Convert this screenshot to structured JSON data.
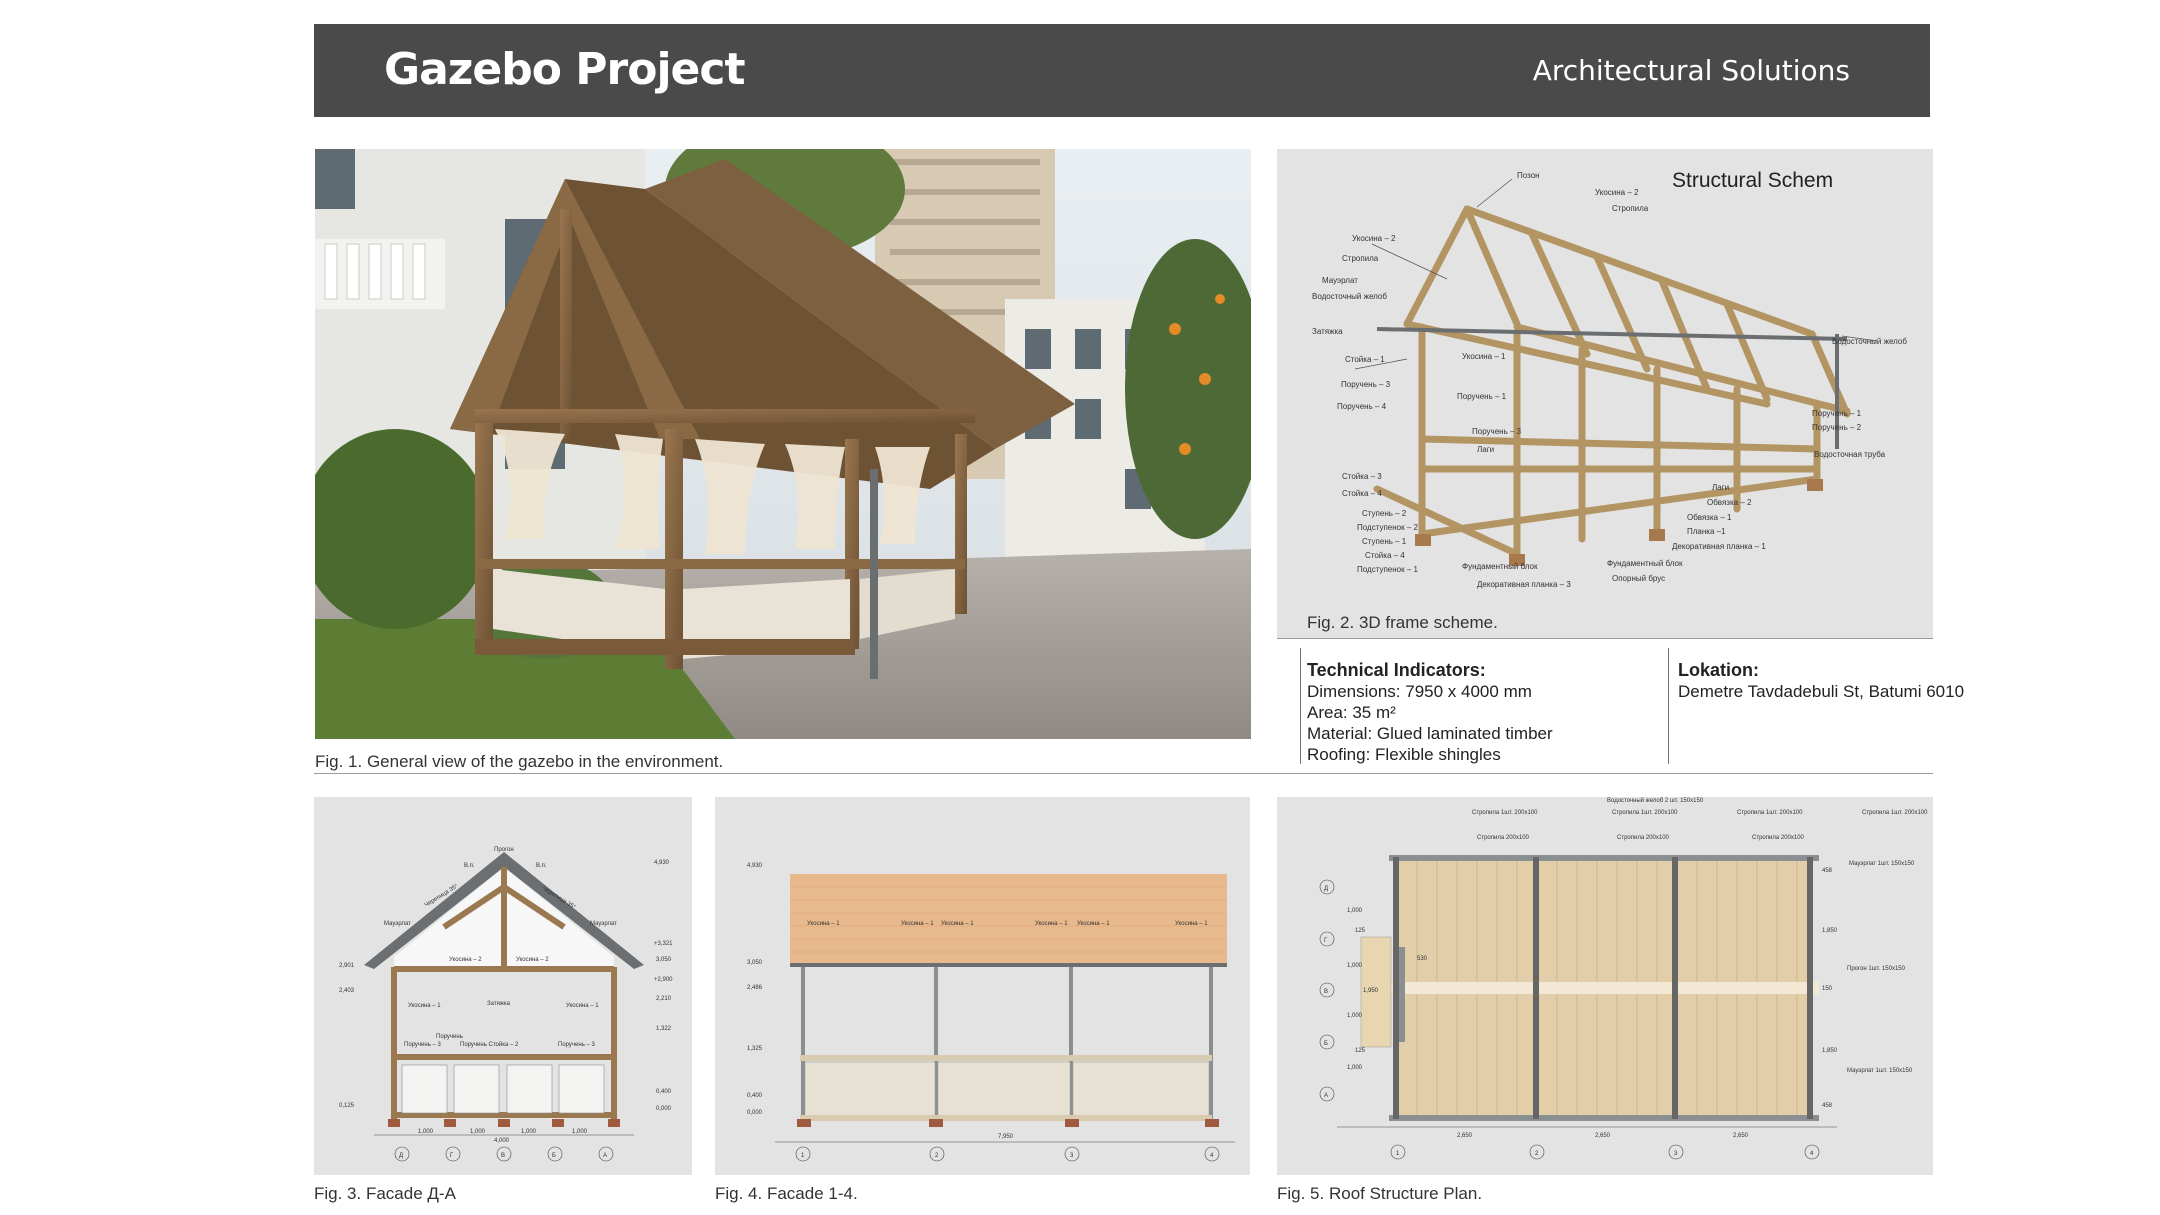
{
  "header": {
    "title": "Gazebo Project",
    "subtitle": "Architectural Solutions"
  },
  "fig1": {
    "caption": "Fig. 1. General view of the gazebo in the environment."
  },
  "fig2": {
    "title": "Structural Schem",
    "caption": "Fig. 2. 3D frame scheme.",
    "labels": {
      "pozon": "Позон",
      "ukosina2_top": "Укосина – 2",
      "stropila_top": "Стропила",
      "ukosina2_left": "Укосина – 2",
      "stropila_left": "Стропила",
      "mauerlat": "Мауэрлат",
      "vodostok_left": "Водосточный желоб",
      "zatyazhka": "Затяжка",
      "stoika1": "Стойка – 1",
      "ukosina1": "Укосина – 1",
      "poruchen3": "Поручень – 3",
      "poruchen4": "Поручень – 4",
      "poruchen1_mid": "Поручень – 1",
      "poruchen3_mid": "Поручень – 3",
      "lagi_mid": "Лаги",
      "stoika3": "Стойка – 3",
      "stoika4": "Стойка – 4",
      "stupen2": "Ступень – 2",
      "podstupenok2": "Подступенок – 2",
      "stupen1": "Ступень – 1",
      "stoika4b": "Стойка – 4",
      "podstupenok1": "Подступенок – 1",
      "fund_block_left": "Фундаментный блок",
      "dekor_planka3": "Декоративная планка – 3",
      "vodostok_right": "Водосточный желоб",
      "poruchen1_right": "Поручень – 1",
      "poruchen2_right": "Поручень – 2",
      "vodostok_truba": "Водосточная труба",
      "lagi_right": "Лаги",
      "obvyazka2": "Обвязка – 2",
      "obvyazka1": "Обвязка – 1",
      "planka1": "Планка –1",
      "dekor_planka1": "Декоративная планка – 1",
      "fund_block_right": "Фундаментный блок",
      "opornyi_brus": "Опорный брус"
    }
  },
  "tech": {
    "heading": "Technical Indicators:",
    "dimensions": "Dimensions: 7950 x 4000 mm",
    "area": "Area: 35 m²",
    "material": "Material: Glued laminated timber",
    "roofing": "Roofing: Flexible shingles"
  },
  "location": {
    "heading": "Lokation:",
    "address": "Demetre Tavdadebuli St, Batumi 6010"
  },
  "fig3": {
    "caption": "Fig. 3. Facade Д-А",
    "labels": {
      "pozon": "Прогон",
      "vp_left": "В.п.",
      "vp_right": "В.п.",
      "cherepica_left": "Черепица 35°",
      "cherepica_right": "Черепица 35°",
      "mauerlat_left": "Мауэрлат",
      "mauerlat_right": "Мауэрлат",
      "ukosina2_a": "Укосина – 2",
      "ukosina2_b": "Укосина – 2",
      "zatyazhka": "Затяжка",
      "ukosina1_a": "Укосина – 1",
      "ukosina1_b": "Укосина – 1",
      "poruchen1": "Поручень",
      "poruchen3_a": "Поручень – 3",
      "poruchen_stoika": "Поручень Стойка – 2",
      "poruchen3_b": "Поручень – 3",
      "lvl_4930": "4,930",
      "lvl_3321": "+3,321",
      "lvl_3050": "3,050",
      "lvl_2900": "+2,900",
      "lvl_2210": "2,210",
      "lvl_1322": "1,322",
      "lvl_0400": "0,400",
      "lvl_0000": "0,000",
      "lvl_2901": "2,901",
      "lvl_2403": "2,403",
      "lvl_0125": "0,125",
      "dim_1000a": "1,000",
      "dim_1000b": "1,000",
      "dim_1000c": "1,000",
      "dim_1000d": "1,000",
      "dim_total": "4,000",
      "axis_d": "Д",
      "axis_g": "Г",
      "axis_v": "В",
      "axis_b": "Б",
      "axis_a": "А"
    }
  },
  "fig4": {
    "caption": "Fig. 4. Facade 1-4.",
    "labels": {
      "lvl_4930": "4,930",
      "lvl_3050": "3,050",
      "lvl_2486": "2,486",
      "lvl_1325": "1,325",
      "lvl_0400": "0,400",
      "lvl_0000": "0,000",
      "ukosina_1a": "Укосина – 1",
      "ukosina_1b": "Укосина – 1",
      "ukosina_1c": "Укосина – 1",
      "ukosina_1d": "Укосина – 1",
      "ukosina_1e": "Укосина – 1",
      "ukosina_1f": "Укосина – 1",
      "dim_total": "7,950",
      "axis_1": "1",
      "axis_2": "2",
      "axis_3": "3",
      "axis_4": "4"
    }
  },
  "fig5": {
    "caption": "Fig. 5. Roof Structure Plan.",
    "labels": {
      "vodostok": "Водосточный желоб 2 шт. 150х150",
      "stropila_a": "Стропила 1шт. 200х100",
      "stropila_b": "Стропила 200х100",
      "stropila_c": "Стропила 1шт. 200х100",
      "stropila_d": "Стропила 200х100",
      "stropila_e": "Стропила 1шт. 200х100",
      "stropila_f": "Стропила 200х100",
      "stropila_g": "Стропила 1шт. 200х100",
      "mauerlat_top": "Мауэрлат 1шт. 150х150",
      "progon": "Прогон 1шт. 150х150",
      "mauerlat_bottom": "Мауэрлат 1шт. 150х150",
      "spacing": "530",
      "dim_2650a": "2,650",
      "dim_2650b": "2,650",
      "dim_2650c": "2,650",
      "dim_1000a": "1,000",
      "dim_1000b": "1,000",
      "dim_1000c": "1,000",
      "dim_1000d": "1,000",
      "dim_125a": "125",
      "dim_125b": "125",
      "dim_1950": "1,950",
      "dim_458a": "458",
      "dim_1850a": "1,850",
      "dim_150": "150",
      "dim_1850b": "1,850",
      "dim_458b": "458",
      "axis_d": "Д",
      "axis_g": "Г",
      "axis_v": "В",
      "axis_b": "Б",
      "axis_a": "А",
      "axis_1": "1",
      "axis_2": "2",
      "axis_3": "3",
      "axis_4": "4"
    }
  }
}
